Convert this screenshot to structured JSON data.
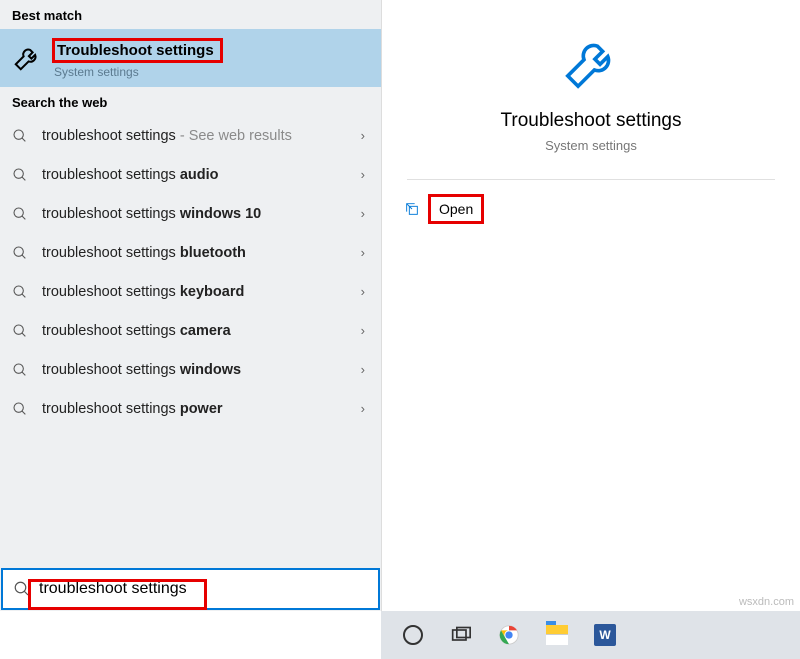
{
  "section_best": "Best match",
  "best_match": {
    "title": "Troubleshoot settings",
    "subtitle": "System settings"
  },
  "section_web": "Search the web",
  "web_results": [
    {
      "prefix": "troubleshoot settings",
      "bold": "",
      "suffix": " - See web results",
      "seeweb": true
    },
    {
      "prefix": "troubleshoot settings ",
      "bold": "audio",
      "suffix": ""
    },
    {
      "prefix": "troubleshoot settings ",
      "bold": "windows 10",
      "suffix": ""
    },
    {
      "prefix": "troubleshoot settings ",
      "bold": "bluetooth",
      "suffix": ""
    },
    {
      "prefix": "troubleshoot settings ",
      "bold": "keyboard",
      "suffix": ""
    },
    {
      "prefix": "troubleshoot settings ",
      "bold": "camera",
      "suffix": ""
    },
    {
      "prefix": "troubleshoot settings ",
      "bold": "windows",
      "suffix": ""
    },
    {
      "prefix": "troubleshoot settings ",
      "bold": "power",
      "suffix": ""
    }
  ],
  "search_value": "troubleshoot settings",
  "preview": {
    "title": "Troubleshoot settings",
    "subtitle": "System settings",
    "open_label": "Open"
  },
  "watermark": "wsxdn.com",
  "word_glyph": "W"
}
